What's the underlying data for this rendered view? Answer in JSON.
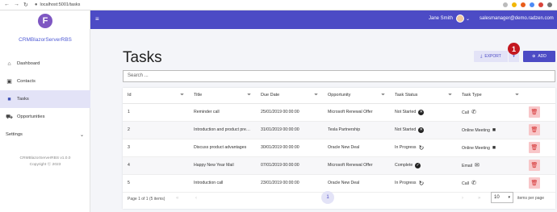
{
  "browser": {
    "url": "localhost:5001/tasks",
    "nav_back": "←",
    "nav_forward": "→",
    "nav_reload": "↻"
  },
  "sidebar": {
    "logo_letter": "F",
    "app_name": "CRMBlazorServerRBS",
    "items": [
      {
        "label": "Dashboard",
        "icon": "home-icon",
        "glyph": "⌂"
      },
      {
        "label": "Contacts",
        "icon": "contacts-icon",
        "glyph": "▣"
      },
      {
        "label": "Tasks",
        "icon": "briefcase-icon",
        "glyph": "■"
      },
      {
        "label": "Opportunities",
        "icon": "cart-icon",
        "glyph": "⛟"
      },
      {
        "label": "Settings",
        "icon": "chevron-down-icon",
        "glyph": "⌄"
      }
    ],
    "footer_line1": "CRMBlazorServerRBS v1.0.0",
    "footer_line2": "Copyright Ⓒ 2023"
  },
  "topbar": {
    "menu_glyph": "≡",
    "user_name": "Jane Smith",
    "caret": "⌄",
    "email": "salesmanager@demo.radzen.com"
  },
  "page": {
    "title": "Tasks",
    "export_label": "EXPORT",
    "export_icon_glyph": "⤓",
    "split_glyph": "▾",
    "badge": "1",
    "add_label": "ADD",
    "add_icon_glyph": "⊕",
    "search_placeholder": "Search ..."
  },
  "table": {
    "filter_glyph": "⏷",
    "columns": [
      "Id",
      "Title",
      "Due Date",
      "Opportunity",
      "Task Status",
      "Task Type"
    ],
    "rows": [
      {
        "id": "1",
        "title": "Reminder call",
        "due": "25/01/2019 00:00:00",
        "opp": "Microsoft Renewal Offer",
        "status": "Not Started",
        "status_glyph": "✕",
        "status_plain": false,
        "type": "Call",
        "type_glyph": "✆"
      },
      {
        "id": "2",
        "title": "Introduction and product pre…",
        "due": "31/01/2019 00:00:00",
        "opp": "Tesla Partnership",
        "status": "Not Started",
        "status_glyph": "✕",
        "status_plain": false,
        "type": "Online Meeting",
        "type_glyph": "■"
      },
      {
        "id": "3",
        "title": "Discuss product advantages",
        "due": "30/01/2019 00:00:00",
        "opp": "Oracle New Deal",
        "status": "In Progress",
        "status_glyph": "↻",
        "status_plain": true,
        "type": "Online Meeting",
        "type_glyph": "■"
      },
      {
        "id": "4",
        "title": "Happy New Year Mail",
        "due": "07/01/2019 00:00:00",
        "opp": "Microsoft Renewal Offer",
        "status": "Complete",
        "status_glyph": "✓",
        "status_plain": false,
        "type": "Email",
        "type_glyph": "✉"
      },
      {
        "id": "5",
        "title": "Introduction call",
        "due": "23/01/2019 00:00:00",
        "opp": "Oracle New Deal",
        "status": "In Progress",
        "status_glyph": "↻",
        "status_plain": true,
        "type": "Call",
        "type_glyph": "✆"
      }
    ],
    "delete_glyph": "🗑"
  },
  "pager": {
    "info": "Page 1 of 1 (5 items)",
    "first": "«",
    "prev": "‹",
    "next": "›",
    "last": "»",
    "current": "1",
    "page_size": "10",
    "page_size_caret": "▾",
    "per_page_label": "items per page"
  }
}
